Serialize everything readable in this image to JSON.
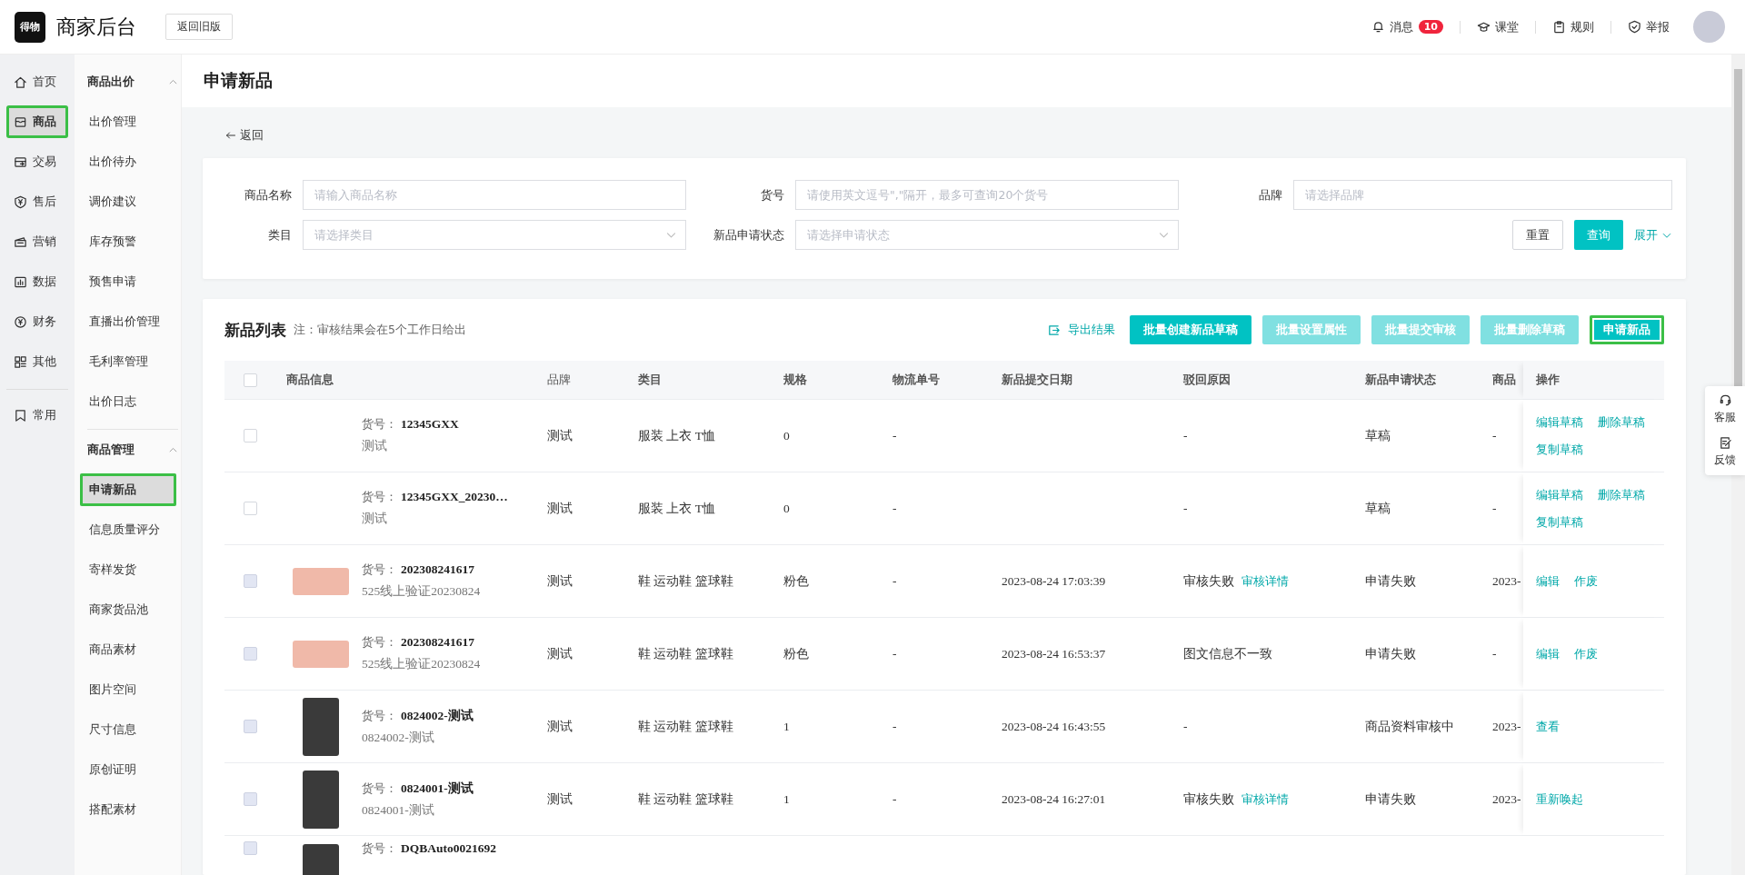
{
  "header": {
    "logo": "得物",
    "brand": "商家后台",
    "old_version_button": "返回旧版",
    "nav": [
      {
        "label": "消息",
        "badge": "10"
      },
      {
        "label": "课堂"
      },
      {
        "label": "规则"
      },
      {
        "label": "举报"
      }
    ]
  },
  "rail": [
    {
      "label": "首页",
      "selected": false,
      "highlighted": false
    },
    {
      "label": "商品",
      "selected": true,
      "highlighted": true
    },
    {
      "label": "交易",
      "selected": false,
      "highlighted": false
    },
    {
      "label": "售后",
      "selected": false,
      "highlighted": false
    },
    {
      "label": "营销",
      "selected": false,
      "highlighted": false
    },
    {
      "label": "数据",
      "selected": false,
      "highlighted": false
    },
    {
      "label": "财务",
      "selected": false,
      "highlighted": false
    },
    {
      "label": "其他",
      "selected": false,
      "highlighted": false
    }
  ],
  "rail_pinned": [
    {
      "label": "常用",
      "selected": false,
      "highlighted": false
    }
  ],
  "submenu": [
    {
      "title": "商品出价",
      "expanded": true,
      "items": [
        {
          "label": "出价管理",
          "selected": false,
          "highlighted": false
        },
        {
          "label": "出价待办",
          "selected": false,
          "highlighted": false
        },
        {
          "label": "调价建议",
          "selected": false,
          "highlighted": false
        },
        {
          "label": "库存预警",
          "selected": false,
          "highlighted": false
        },
        {
          "label": "预售申请",
          "selected": false,
          "highlighted": false
        },
        {
          "label": "直播出价管理",
          "selected": false,
          "highlighted": false
        },
        {
          "label": "毛利率管理",
          "selected": false,
          "highlighted": false
        },
        {
          "label": "出价日志",
          "selected": false,
          "highlighted": false
        }
      ]
    },
    {
      "title": "商品管理",
      "expanded": true,
      "items": [
        {
          "label": "申请新品",
          "selected": true,
          "highlighted": true
        },
        {
          "label": "信息质量评分",
          "selected": false,
          "highlighted": false
        },
        {
          "label": "寄样发货",
          "selected": false,
          "highlighted": false
        },
        {
          "label": "商家货品池",
          "selected": false,
          "highlighted": false
        },
        {
          "label": "商品素材",
          "selected": false,
          "highlighted": false
        },
        {
          "label": "图片空间",
          "selected": false,
          "highlighted": false
        },
        {
          "label": "尺寸信息",
          "selected": false,
          "highlighted": false
        },
        {
          "label": "原创证明",
          "selected": false,
          "highlighted": false
        },
        {
          "label": "搭配素材",
          "selected": false,
          "highlighted": false
        }
      ]
    }
  ],
  "page_title": "申请新品",
  "back_link": "返回",
  "filters": [
    {
      "label": "商品名称",
      "placeholder": "请输入商品名称",
      "kind": "text"
    },
    {
      "label": "货号",
      "placeholder": "请使用英文逗号\",\"隔开，最多可查询20个货号",
      "kind": "text"
    },
    {
      "label": "品牌",
      "placeholder": "请选择品牌",
      "kind": "text"
    },
    {
      "label": "类目",
      "placeholder": "请选择类目",
      "kind": "select"
    },
    {
      "label": "新品申请状态",
      "placeholder": "请选择申请状态",
      "kind": "select"
    }
  ],
  "filter_buttons": {
    "reset": "重置",
    "query": "查询",
    "expand": "展开"
  },
  "list": {
    "title": "新品列表",
    "note": "注：审核结果会在5个工作日给出",
    "export": "导出结果",
    "actions": [
      {
        "label": "批量创建新品草稿",
        "disabled": false,
        "highlighted": false
      },
      {
        "label": "批量设置属性",
        "disabled": true,
        "highlighted": false
      },
      {
        "label": "批量提交审核",
        "disabled": true,
        "highlighted": false
      },
      {
        "label": "批量删除草稿",
        "disabled": true,
        "highlighted": false
      },
      {
        "label": "申请新品",
        "disabled": false,
        "highlighted": true
      }
    ]
  },
  "table": {
    "header_checked": false,
    "columns": [
      "商品信息",
      "品牌",
      "类目",
      "规格",
      "物流单号",
      "新品提交日期",
      "驳回原因",
      "新品申请状态",
      "商品",
      "操作"
    ],
    "rows": [
      {
        "checked": false,
        "disabled": false,
        "kind": "no_image",
        "sku_label": "货号：",
        "sku": "12345GXX",
        "name": "测试",
        "brand": "测试",
        "category": "服装 上衣 T恤",
        "spec": "0",
        "logistics": "-",
        "reason": "-",
        "status": "草稿",
        "column_9": "-",
        "actions": [
          "编辑草稿",
          "删除草稿",
          "复制草稿"
        ]
      },
      {
        "checked": false,
        "disabled": false,
        "kind": "no_image",
        "sku_label": "货号：",
        "sku": "12345GXX_20230…",
        "name": "测试",
        "brand": "测试",
        "category": "服装 上衣 T恤",
        "spec": "0",
        "logistics": "-",
        "reason": "-",
        "status": "草稿",
        "column_9": "-",
        "actions": [
          "编辑草稿",
          "删除草稿",
          "复制草稿"
        ]
      },
      {
        "checked": false,
        "disabled": true,
        "kind": "shoe",
        "sku_label": "货号：",
        "sku": "202308241617",
        "name": "525线上验证20230824",
        "brand": "测试",
        "category": "鞋 运动鞋 篮球鞋",
        "spec": "粉色",
        "logistics": "-",
        "date": "2023-08-24 17:03:39",
        "reason": "审核失败",
        "reason_link": "审核详情",
        "status": "申请失败",
        "column_9": "2023-",
        "actions": [
          "编辑",
          "作废"
        ]
      },
      {
        "checked": false,
        "disabled": true,
        "kind": "shoe",
        "sku_label": "货号：",
        "sku": "202308241617",
        "name": "525线上验证20230824",
        "brand": "测试",
        "category": "鞋 运动鞋 篮球鞋",
        "spec": "粉色",
        "logistics": "-",
        "date": "2023-08-24 16:53:37",
        "reason": "图文信息不一致",
        "status": "申请失败",
        "column_9": "-",
        "actions": [
          "编辑",
          "作废"
        ]
      },
      {
        "checked": false,
        "disabled": true,
        "kind": "person",
        "sku_label": "货号：",
        "sku": "0824002-测试",
        "name": "0824002-测试",
        "brand": "测试",
        "category": "鞋 运动鞋 篮球鞋",
        "spec": "1",
        "logistics": "-",
        "date": "2023-08-24 16:43:55",
        "reason": "-",
        "status": "商品资料审核中",
        "column_9": "2023-",
        "actions": [
          "查看"
        ]
      },
      {
        "checked": false,
        "disabled": true,
        "kind": "person",
        "sku_label": "货号：",
        "sku": "0824001-测试",
        "name": "0824001-测试",
        "brand": "测试",
        "category": "鞋 运动鞋 篮球鞋",
        "spec": "1",
        "logistics": "-",
        "date": "2023-08-24 16:27:01",
        "reason": "审核失败",
        "reason_link": "审核详情",
        "status": "申请失败",
        "column_9": "2023-",
        "actions": [
          "重新唤起"
        ]
      },
      {
        "checked": false,
        "disabled": true,
        "kind": "person",
        "sku_label": "货号：",
        "sku": "DQBAuto0021692"
      }
    ]
  },
  "float_panel": [
    {
      "label": "客服"
    },
    {
      "label": "反馈"
    }
  ]
}
